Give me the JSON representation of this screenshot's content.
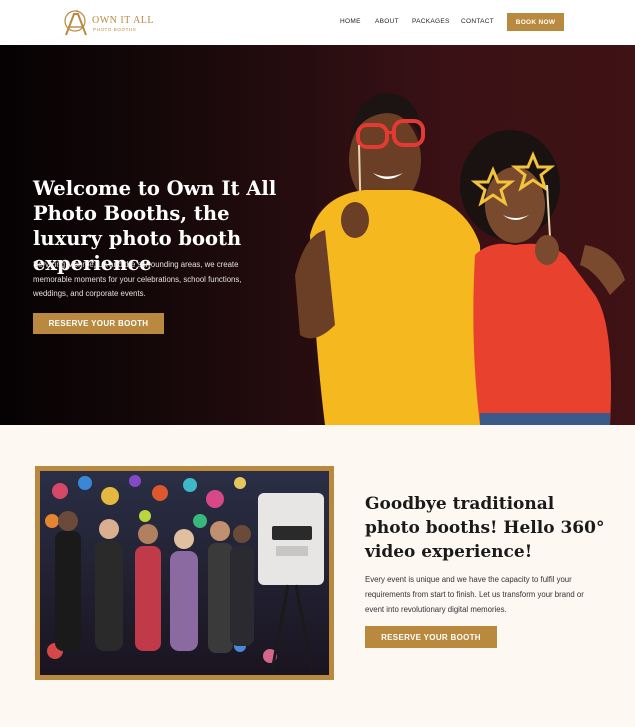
{
  "brand": {
    "name": "OWN IT ALL",
    "tagline": "PHOTO BOOTHS",
    "accent": "#b9893f"
  },
  "nav": {
    "items": [
      "HOME",
      "ABOUT",
      "PACKAGES",
      "CONTACT"
    ],
    "cta": "BOOK NOW"
  },
  "hero": {
    "title": "Welcome to Own It All Photo Booths, the luxury photo booth experience",
    "text": "Servicing Monroe, LA and the surrounding areas, we create memorable  moments for your celebrations, school functions, weddings, and corporate events.",
    "button": "RESERVE YOUR BOOTH"
  },
  "feature": {
    "title": "Goodbye traditional photo booths! Hello 360° video experience!",
    "text": "Every event is unique and we have the capacity to fulfil your requirements from start to finish. Let us transform your brand or event into revolutionary digital memories.",
    "button": "RESERVE YOUR BOOTH"
  }
}
